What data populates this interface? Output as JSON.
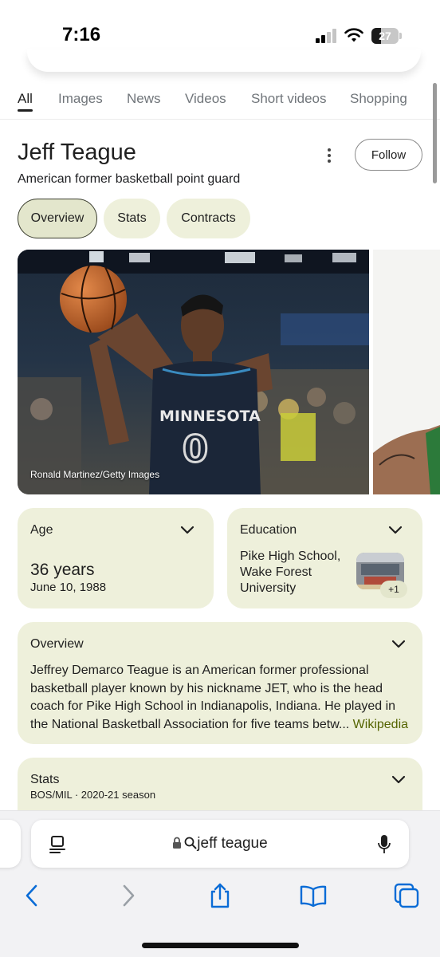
{
  "status_bar": {
    "time": "7:16",
    "battery": "27"
  },
  "tabs": [
    {
      "label": "All",
      "active": true
    },
    {
      "label": "Images"
    },
    {
      "label": "News"
    },
    {
      "label": "Videos"
    },
    {
      "label": "Short videos"
    },
    {
      "label": "Shopping"
    }
  ],
  "entity": {
    "title": "Jeff Teague",
    "subtitle": "American former basketball point guard",
    "follow_label": "Follow"
  },
  "chips": [
    {
      "label": "Overview",
      "selected": true
    },
    {
      "label": "Stats"
    },
    {
      "label": "Contracts"
    }
  ],
  "photo": {
    "credit": "Ronald Martinez/Getty Images",
    "jersey_text": "MINNESOTA",
    "jersey_number": "0"
  },
  "age_card": {
    "label": "Age",
    "value": "36 years",
    "date": "June 10, 1988"
  },
  "education_card": {
    "label": "Education",
    "value": "Pike High School, Wake Forest University",
    "more": "+1"
  },
  "overview_card": {
    "label": "Overview",
    "text": "Jeffrey Demarco Teague is an American former professional basketball player known by his nickname JET, who is the head coach for Pike High School in Indianapolis, Indiana. He played in the National Basketball Association for five teams betw...",
    "source": "Wikipedia"
  },
  "stats_card": {
    "label": "Stats",
    "subtitle": "BOS/MIL · 2020-21 season"
  },
  "browser": {
    "query": "jeff teague"
  },
  "colors": {
    "card_bg": "#eef0db",
    "chip_selected_border": "#3a3d2e",
    "link": "#546400",
    "accent_ios": "#0a6cd6"
  },
  "icons": [
    "signal-icon",
    "wifi-icon",
    "battery-icon",
    "more-vert-icon",
    "chevron-down-icon",
    "lock-icon",
    "search-icon",
    "reader-icon",
    "microphone-icon",
    "back-icon",
    "forward-icon",
    "share-icon",
    "bookmarks-icon",
    "tabs-icon"
  ]
}
